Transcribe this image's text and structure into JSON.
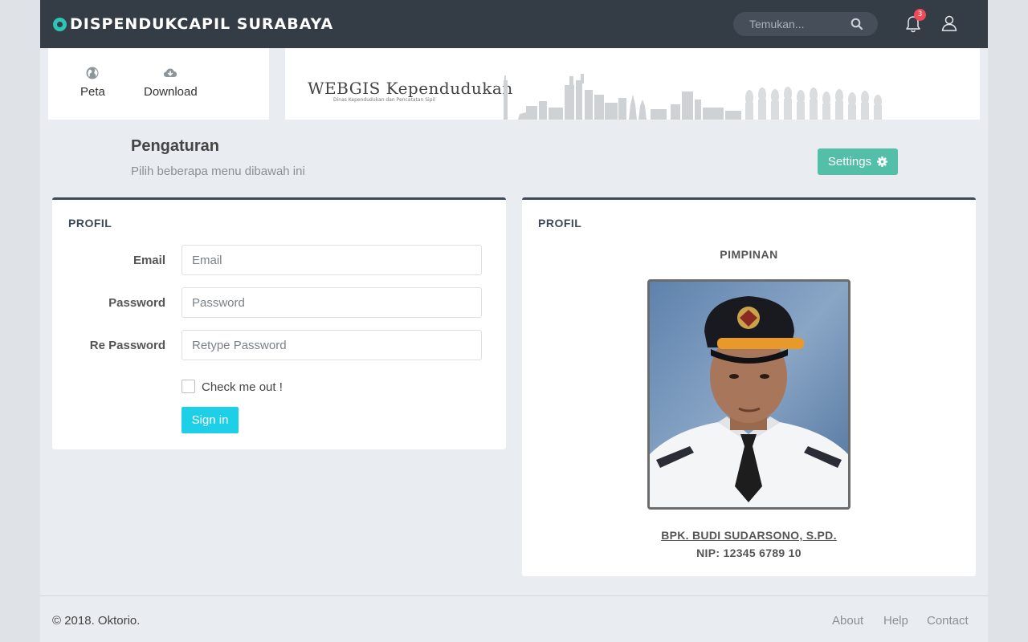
{
  "header": {
    "brand": "DISPENDUKCAPIL SURABAYA",
    "search_placeholder": "Temukan...",
    "notification_count": "3"
  },
  "nav": {
    "items": [
      {
        "label": "Peta",
        "icon": "globe-icon"
      },
      {
        "label": "Download",
        "icon": "cloud-download-icon"
      }
    ]
  },
  "banner": {
    "title": "WEBGIS Kependudukan",
    "subtitle": "Dinas Kependudukan dan Pencatatan Sipil"
  },
  "page": {
    "title": "Pengaturan",
    "subtitle": "Pilih beberapa menu dibawah ini",
    "settings_label": "Settings"
  },
  "profile_form": {
    "title": "PROFIL",
    "email_label": "Email",
    "email_placeholder": "Email",
    "password_label": "Password",
    "password_placeholder": "Password",
    "repassword_label": "Re Password",
    "repassword_placeholder": "Retype Password",
    "check_label": "Check me out !",
    "signin_label": "Sign in"
  },
  "profile_card": {
    "title": "PROFIL",
    "role": "PIMPINAN",
    "name": "BPK. BUDI SUDARSONO, S.PD.",
    "nip": "NIP: 12345 6789 10"
  },
  "footer": {
    "copyright": "© 2018. Oktorio.",
    "links": [
      "About",
      "Help",
      "Contact"
    ]
  },
  "colors": {
    "topbar": "#343d46",
    "accent": "#2ec4b6",
    "settings_button": "#54bfa9",
    "signin_button": "#1ecfe8",
    "badge": "#ee4b5a"
  }
}
